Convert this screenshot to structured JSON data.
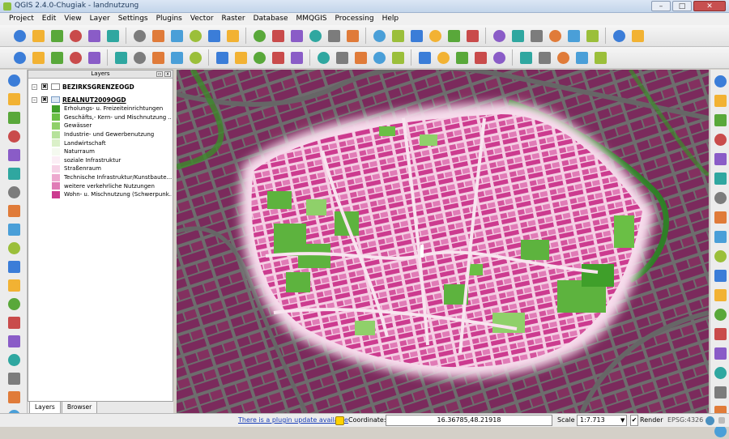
{
  "window": {
    "title": "QGIS 2.4.0-Chugiak - landnutzung",
    "min": "–",
    "max": "□",
    "close": "✕"
  },
  "menu": [
    "Project",
    "Edit",
    "View",
    "Layer",
    "Settings",
    "Plugins",
    "Vector",
    "Raster",
    "Database",
    "MMQGIS",
    "Processing",
    "Help"
  ],
  "toolbar1_icons": [
    "new-project-icon",
    "open-project-icon",
    "save-project-icon",
    "save-as-icon",
    "new-print-composer-icon",
    "composer-manager-icon",
    "add-vector-layer-icon",
    "add-raster-layer-icon",
    "add-postgis-layer-icon",
    "add-spatialite-layer-icon",
    "add-mssql-layer-icon",
    "add-wms-layer-icon",
    "add-wcs-layer-icon",
    "add-wfs-layer-icon",
    "add-delimited-text-icon",
    "new-shapefile-icon",
    "remove-layer-icon",
    "toggle-editing-icon",
    "save-edits-icon",
    "add-feature-icon",
    "move-feature-icon",
    "node-tool-icon",
    "delete-selected-icon",
    "gps-icon",
    "openlayers-icon",
    "python-console-icon",
    "plugin-icon",
    "globe-icon",
    "pie-icon",
    "settings-icon",
    "refresh-icon",
    "help-icon"
  ],
  "toolbar2_icons": [
    "touch-icon",
    "pan-icon",
    "pan-to-selection-icon",
    "zoom-in-icon",
    "zoom-out-icon",
    "zoom-native-icon",
    "zoom-full-icon",
    "zoom-to-selection-icon",
    "zoom-to-layer-icon",
    "zoom-last-icon",
    "zoom-next-icon",
    "refresh-map-icon",
    "identify-icon",
    "action-icon",
    "select-icon",
    "deselect-icon",
    "expression-select-icon",
    "attribute-table-icon",
    "field-calculator-icon",
    "measure-icon",
    "map-tips-icon",
    "bookmark-icon",
    "text-annotation-icon",
    "label-icon",
    "label-pin-icon",
    "label-show-icon",
    "label-move-icon",
    "label-rotate-icon",
    "label-change-icon",
    "leaf-icon"
  ],
  "left_tools": [
    "add-vector-icon",
    "add-raster-icon",
    "add-postgis-icon",
    "add-spatialite-icon",
    "add-mssql-icon",
    "add-wms-icon",
    "add-wcs-icon",
    "add-wfs-icon",
    "add-csv-icon",
    "new-layer-icon",
    "grid-icon",
    "gps-tool-icon",
    "calc-icon",
    "sigma-icon",
    "georef-icon",
    "heatmap-icon",
    "split-icon",
    "globe-side-icon",
    "more-icon"
  ],
  "right_tools": [
    "edit-pencil-icon",
    "pencil-icon",
    "save-right-icon",
    "capture-icon",
    "move-right-icon",
    "node-right-icon",
    "delete-right-icon",
    "cut-icon",
    "copy-icon",
    "paste-icon",
    "undo-icon",
    "redo-icon",
    "rotate-icon",
    "simplify-icon",
    "add-ring-icon",
    "add-part-icon",
    "fill-ring-icon",
    "delete-ring-icon",
    "reshape-icon"
  ],
  "layers_panel": {
    "title": "Layers",
    "layers": [
      {
        "name": "BEZIRKSGRENZEOGD",
        "checked": "✖",
        "expand": "–"
      },
      {
        "name": "REALNUT2009OGD",
        "checked": "✖",
        "expand": "–"
      }
    ],
    "legend": [
      {
        "label": "Erholungs- u. Freizeiteinrichtungen",
        "color": "#3f9f2a"
      },
      {
        "label": "Geschäfts,- Kern- und Mischnutzung ...",
        "color": "#6abf45"
      },
      {
        "label": "Gewässer",
        "color": "#8fd06a"
      },
      {
        "label": "Industrie- und Gewerbenutzung",
        "color": "#b6e29b"
      },
      {
        "label": "Landwirtschaft",
        "color": "#daf0c8"
      },
      {
        "label": "Naturraum",
        "color": "#f4f9ef"
      },
      {
        "label": "soziale Infrastruktur",
        "color": "#fbeef5"
      },
      {
        "label": "Straßenraum",
        "color": "#f6d2e6"
      },
      {
        "label": "Technische Infrastruktur/Kunstbaute...",
        "color": "#eda9cf"
      },
      {
        "label": "weitere verkehrliche Nutzungen",
        "color": "#e07bb6"
      },
      {
        "label": "Wohn- u. Mischnutzung (Schwerpunk...",
        "color": "#cc3b8f"
      }
    ],
    "tabs": [
      "Layers",
      "Browser"
    ]
  },
  "status": {
    "plugin_update": "There is a plugin update available",
    "coordinate_label": "Coordinate:",
    "coordinate_value": "16.36785,48.21918",
    "scale_label": "Scale",
    "scale_value": "1:7.713",
    "render_label": "Render",
    "render_checked": "✔",
    "crs": "EPSG:4326"
  },
  "map": {
    "road_color": "#6c6c6c",
    "outer_color": "#7d2a5d",
    "center_glow": "#f7e6f0"
  }
}
